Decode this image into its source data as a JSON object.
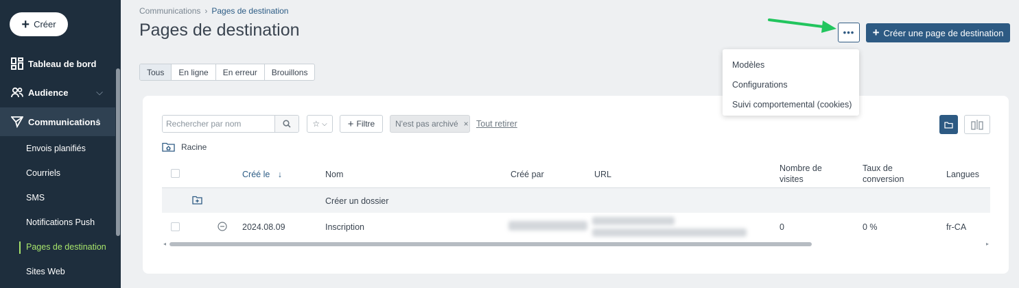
{
  "sidebar": {
    "create_label": "Créer",
    "nav": [
      {
        "label": "Tableau de bord",
        "icon": "dashboard-icon"
      },
      {
        "label": "Audience",
        "icon": "audience-icon"
      },
      {
        "label": "Communications",
        "icon": "send-icon"
      }
    ],
    "sub_items": [
      "Envois planifiés",
      "Courriels",
      "SMS",
      "Notifications Push",
      "Pages de destination",
      "Sites Web"
    ]
  },
  "breadcrumb": [
    "Communications",
    "Pages de destination"
  ],
  "page_title": "Pages de destination",
  "header": {
    "more_label": "•••",
    "create_page_label": "Créer une page de destination"
  },
  "tabs": [
    "Tous",
    "En ligne",
    "En erreur",
    "Brouillons"
  ],
  "dropdown": [
    "Modèles",
    "Configurations",
    "Suivi comportemental (cookies)"
  ],
  "toolbar": {
    "search_placeholder": "Rechercher par nom",
    "filter_label": "Filtre",
    "chip_label": "N'est pas archivé",
    "chip_close": "×",
    "clear_all": "Tout retirer",
    "root_label": "Racine"
  },
  "table": {
    "headers": {
      "created": "Créé le",
      "name": "Nom",
      "created_by": "Créé par",
      "url": "URL",
      "visits_1": "Nombre de",
      "visits_2": "visites",
      "rate_1": "Taux de",
      "rate_2": "conversion",
      "languages": "Langues"
    },
    "create_folder": "Créer un dossier",
    "rows": [
      {
        "date": "2024.08.09",
        "name": "Inscription",
        "visits": "0",
        "rate": "0 %",
        "lang": "fr-CA"
      }
    ]
  },
  "colors": {
    "sidebar_bg": "#1e2e3d",
    "accent": "#2d5a83",
    "active_subitem": "#a7e46b",
    "annotation_arrow": "#22c55e"
  }
}
